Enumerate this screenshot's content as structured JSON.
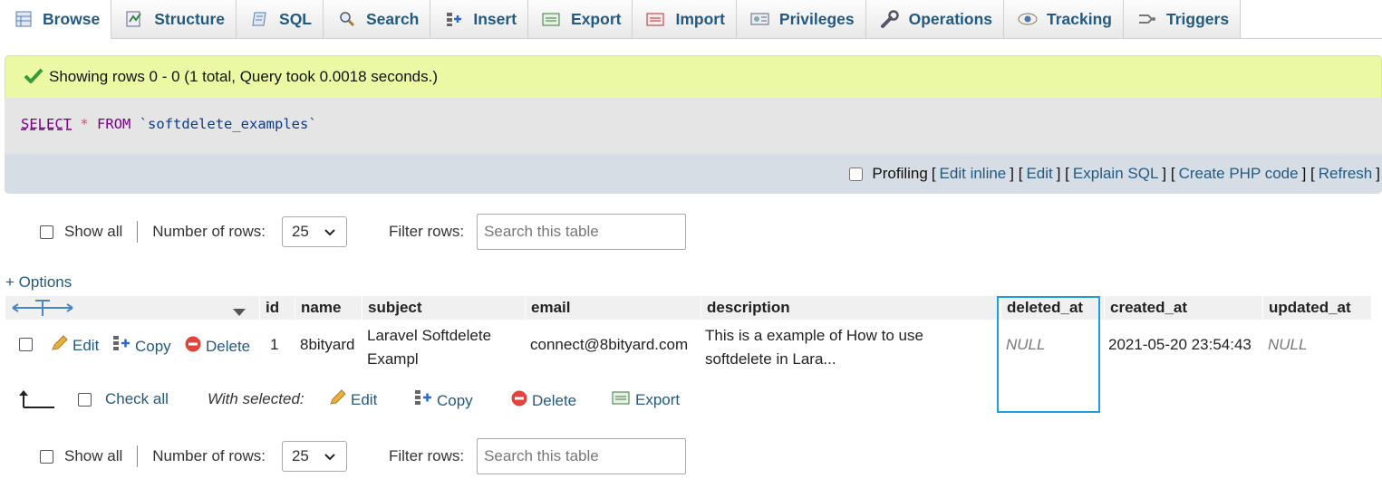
{
  "tabs": [
    {
      "label": "Browse",
      "icon": "browse-icon",
      "active": true
    },
    {
      "label": "Structure",
      "icon": "structure-icon"
    },
    {
      "label": "SQL",
      "icon": "sql-icon"
    },
    {
      "label": "Search",
      "icon": "search-icon"
    },
    {
      "label": "Insert",
      "icon": "insert-icon"
    },
    {
      "label": "Export",
      "icon": "export-icon"
    },
    {
      "label": "Import",
      "icon": "import-icon"
    },
    {
      "label": "Privileges",
      "icon": "privileges-icon"
    },
    {
      "label": "Operations",
      "icon": "wrench-icon"
    },
    {
      "label": "Tracking",
      "icon": "eye-icon"
    },
    {
      "label": "Triggers",
      "icon": "triggers-icon"
    }
  ],
  "message": {
    "prefix": "Showing rows 0 - 0 (1 total, Query took 0.0018 seconds.)",
    "color": "#ebf8a4"
  },
  "sql": {
    "select": "SELECT",
    "star": "*",
    "from": "FROM",
    "table": "`softdelete_examples`"
  },
  "query_actions": {
    "profiling": "Profiling",
    "links": [
      "Edit inline",
      "Edit",
      "Explain SQL",
      "Create PHP code",
      "Refresh"
    ]
  },
  "nav": {
    "show_all": "Show all",
    "rows_label": "Number of rows:",
    "rows_value": "25",
    "filter_label": "Filter rows:",
    "filter_placeholder": "Search this table"
  },
  "options_link": "+ Options",
  "columns": [
    "id",
    "name",
    "subject",
    "email",
    "description",
    "deleted_at",
    "created_at",
    "updated_at"
  ],
  "row": {
    "actions": [
      "Edit",
      "Copy",
      "Delete"
    ],
    "id": "1",
    "name": "8bityard",
    "subject_l1": "Laravel Softdelete",
    "subject_l2": "Exampl",
    "email": "connect@8bityard.com",
    "description_l1": "This is a example of How to use",
    "description_l2": "softdelete in Lara...",
    "deleted_at": "NULL",
    "created_at": "2021-05-20 23:54:43",
    "updated_at": "NULL"
  },
  "bulk": {
    "check_all": "Check all",
    "with_selected": "With selected:",
    "edit": "Edit",
    "copy": "Copy",
    "delete": "Delete",
    "export": "Export"
  },
  "colors": {
    "link": "#235a81",
    "highlight": "#1aa0dc",
    "header_bg": "#f0f0f0"
  }
}
